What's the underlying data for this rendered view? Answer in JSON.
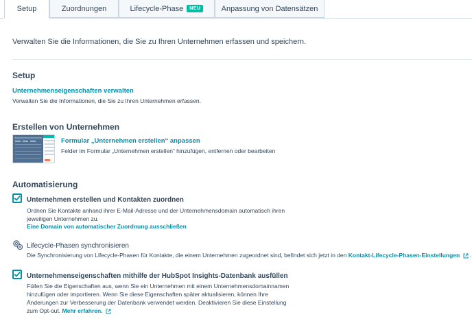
{
  "tabs": [
    {
      "label": "Setup",
      "active": true
    },
    {
      "label": "Zuordnungen",
      "active": false
    },
    {
      "label": "Lifecycle-Phase",
      "active": false,
      "badge": "NEU"
    },
    {
      "label": "Anpassung von Datensätzen",
      "active": false
    }
  ],
  "intro": "Verwalten Sie die Informationen, die Sie zu Ihren Unternehmen erfassen und speichern.",
  "setup": {
    "heading": "Setup",
    "link": "Unternehmenseigenschaften verwalten",
    "desc": "Verwalten Sie die Informationen, die Sie zu Ihren Unternehmen erfassen."
  },
  "create": {
    "heading": "Erstellen von Unternehmen",
    "link": "Formular „Unternehmen erstellen“ anpassen",
    "desc": "Felder im Formular „Unternehmen erstellen“ hinzufügen, entfernen oder bearbeiten"
  },
  "automation": {
    "heading": "Automatisierung",
    "item1": {
      "title": "Unternehmen erstellen und Kontakten zuordnen",
      "desc_line1": "Ordnen Sie Kontakte anhand ihrer E-Mail-Adresse und der Unternehmensdomain automatisch ihren",
      "desc_line2": "jeweiligen Unternehmen zu.",
      "link": "Eine Domain von automatischer Zuordnung ausschließen",
      "checked": true
    },
    "item2": {
      "title": "Lifecycle-Phasen synchronisieren",
      "desc": "Die Synchronisierung von Lifecycle-Phasen für Kontakte, die einem Unternehmen zugeordnet sind, befindet sich jetzt in den",
      "link": "Kontakt-Lifecycle-Phasen-Einstellungen",
      "suffix": "."
    },
    "item3": {
      "title": "Unternehmenseigenschaften mithilfe der HubSpot Insights-Datenbank ausfüllen",
      "desc_line1": "Füllen Sie die Eigenschaften aus, wenn Sie ein Unternehmen mit einem Unternehmensdomainnamen",
      "desc_line2": "hinzufügen oder importieren. Wenn Sie diese Eigenschaften später aktualisieren, können Ihre",
      "desc_line3": "Änderungen zur Verbesserung der Datenbank verwendet werden. Deaktivieren Sie diese Einstellung",
      "desc_line4_prefix": "zum Opt-out.",
      "link": "Mehr erfahren.",
      "checked": true
    }
  },
  "colors": {
    "link": "#0091ae",
    "text": "#33475b",
    "badge": "#00bda5",
    "border": "#cbd6e2"
  },
  "icons": {
    "check": "checkmark-icon",
    "sync": "sync-gears-icon",
    "external": "external-link-icon"
  }
}
